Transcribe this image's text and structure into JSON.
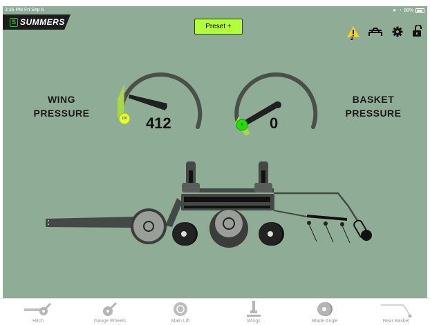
{
  "status_bar": {
    "time": "3:36 PM  Fri Sep 6",
    "battery": "88%"
  },
  "brand": {
    "name": "SUMMERS",
    "mark": "S"
  },
  "preset_button": {
    "label": "Preset +"
  },
  "top_icons": {
    "warning_count": "2",
    "warning_icon": "warning-icon",
    "hitch_icon": "hitch-icon",
    "settings_icon": "gear-icon",
    "lock_icon": "unlock-icon"
  },
  "wing": {
    "label_line1": "WING",
    "label_line2": "PRESSURE",
    "value": "412",
    "setpoint": "100"
  },
  "basket": {
    "label_line1": "BASKET",
    "label_line2": "PRESSURE",
    "value": "0",
    "setpoint": "0"
  },
  "colors": {
    "background": "#8fac96",
    "accent": "#b2ff3c",
    "green_marker": "#22e000",
    "dark": "#3a3f3a"
  },
  "tabs": [
    {
      "label": "Hitch",
      "icon": "hitch-tab-icon"
    },
    {
      "label": "Gauge Wheels",
      "icon": "gauge-wheel-icon"
    },
    {
      "label": "Main Lift",
      "icon": "wheel-icon"
    },
    {
      "label": "Wings",
      "icon": "wings-icon"
    },
    {
      "label": "Blade Angle",
      "icon": "blade-icon"
    },
    {
      "label": "Rear Basket",
      "icon": "basket-icon"
    }
  ]
}
